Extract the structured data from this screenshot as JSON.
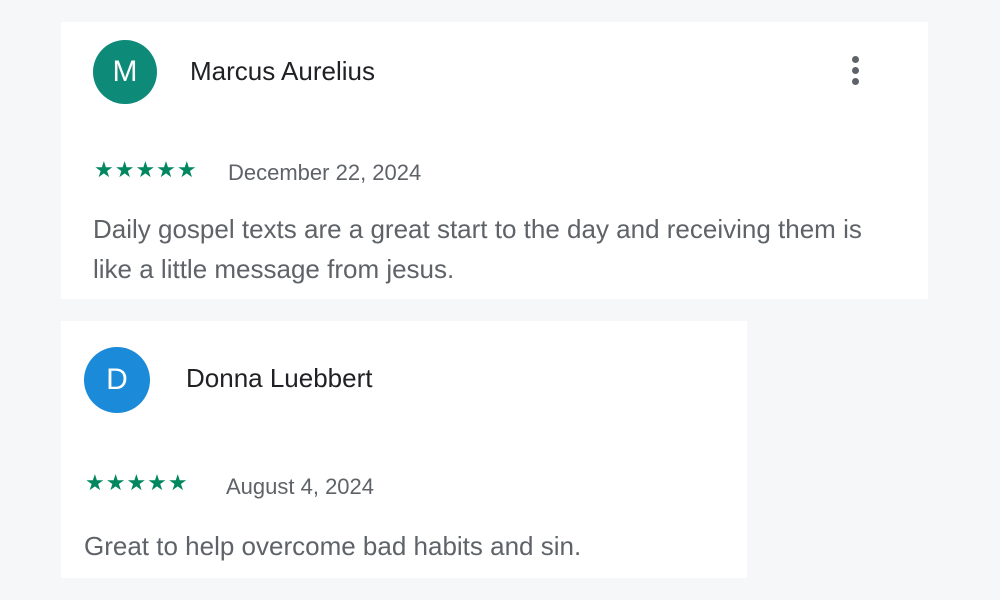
{
  "reviews": [
    {
      "avatar_letter": "M",
      "avatar_color": "#0d8a78",
      "name": "Marcus Aurelius",
      "rating": 5,
      "stars": "★★★★★",
      "date": "December 22, 2024",
      "text": "Daily gospel texts are a great start to the day and receiving them is like a little message from jesus.",
      "menu_icon": "more-vert-icon"
    },
    {
      "avatar_letter": "D",
      "avatar_color": "#1b8ad8",
      "name": "Donna Luebbert",
      "rating": 5,
      "stars": "★★★★★",
      "date": "August 4, 2024",
      "text": "Great to help overcome bad habits and sin."
    }
  ],
  "colors": {
    "background": "#f6f7f9",
    "star": "#01875f",
    "secondary_text": "#5f6368",
    "primary_text": "#202124"
  }
}
